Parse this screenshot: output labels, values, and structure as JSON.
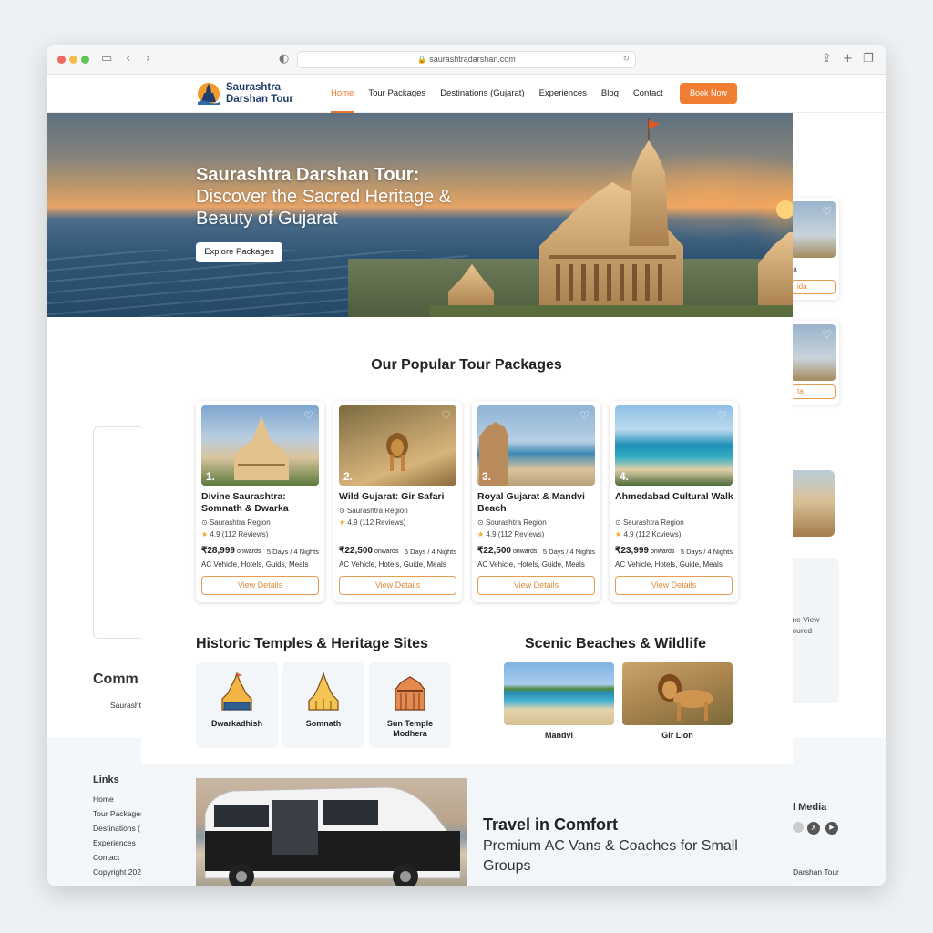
{
  "browser": {
    "url": "saurashtradarshan.com"
  },
  "nav": {
    "logo_line1": "Saurashtra",
    "logo_line2": "Darshan Tour",
    "links": [
      "Home",
      "Tour Packages",
      "Destinations (Gujarat)",
      "Experiences",
      "Blog",
      "Contact"
    ],
    "active": "Home",
    "cta": "Book Now"
  },
  "hero": {
    "title_bold": "Saurashtra Darshan Tour:",
    "title_rest": "Discover the Sacred Heritage & Beauty of Gujarat",
    "button": "Explore Packages"
  },
  "packages": {
    "heading": "Our Popular Tour Packages",
    "items": [
      {
        "num": "1.",
        "title": "Divine Saurashtra: Somnath & Dwarka",
        "location": "Saurashtra Region",
        "rating": "4.9 (112 Reviews)",
        "price": "₹28,999",
        "onwards": "onwards",
        "duration": "5 Days / 4 Nights",
        "includes": "AC Vehicle, Hotels, Guids, Meals",
        "button": "View Details"
      },
      {
        "num": "2.",
        "title": "Wild Gujarat: Gir Safari",
        "location": "Saurashtra Region",
        "rating": "4.9 (112 Reviews)",
        "price": "₹22,500",
        "onwards": "onwards",
        "duration": "5 Days / 4 Nights",
        "includes": "AC Vehicle, Hotels, Guide, Meals",
        "button": "View Details"
      },
      {
        "num": "3.",
        "title": "Royal Gujarat & Mandvi Beach",
        "location": "Sourashtra Region",
        "rating": "4.9 (112 Reviews)",
        "price": "₹22,500",
        "onwards": "onwards",
        "duration": "5 Days / 4 Nights",
        "includes": "AC Vehicle, Hotels, Guide, Meals",
        "button": "View Details"
      },
      {
        "num": "4.",
        "title": "Ahmedabad Cultural Walk",
        "location": "Seurashtra Region",
        "rating": "4.9 (112 Kcviews)",
        "price": "₹23,999",
        "onwards": "onwards",
        "duration": "5 Days / 4 Nights",
        "includes": "AC Vehicle, Hotels, Guide, Meals",
        "button": "View Details"
      }
    ]
  },
  "heritage": {
    "heading": "Historic Temples & Heritage Sites",
    "items": [
      "Dwarkadhish",
      "Somnath",
      "Sun Temple Modhera"
    ]
  },
  "scenic": {
    "heading": "Scenic Beaches & Wildlife",
    "items": [
      "Mandvi",
      "Gir Lion"
    ]
  },
  "comfort": {
    "title": "Travel in Comfort",
    "subtitle": "Premium AC Vans & Coaches for Small Groups"
  },
  "background_page": {
    "comm_heading": "Comm",
    "saurash": "Saurasht",
    "footer_links_heading": "Links",
    "footer_links": [
      "Home",
      "Tour Packages",
      "Destinations (",
      "Experiences",
      "Contact"
    ],
    "copyright": "Copyright 202",
    "social_heading": "l Media",
    "brand_tail": "Darshan Tour",
    "side_text1": "me View",
    "side_text2": "toured",
    "card_text": "ta",
    "card_btn": "ida"
  },
  "colors": {
    "accent": "#ef7d32",
    "navy": "#1f3d6b"
  }
}
